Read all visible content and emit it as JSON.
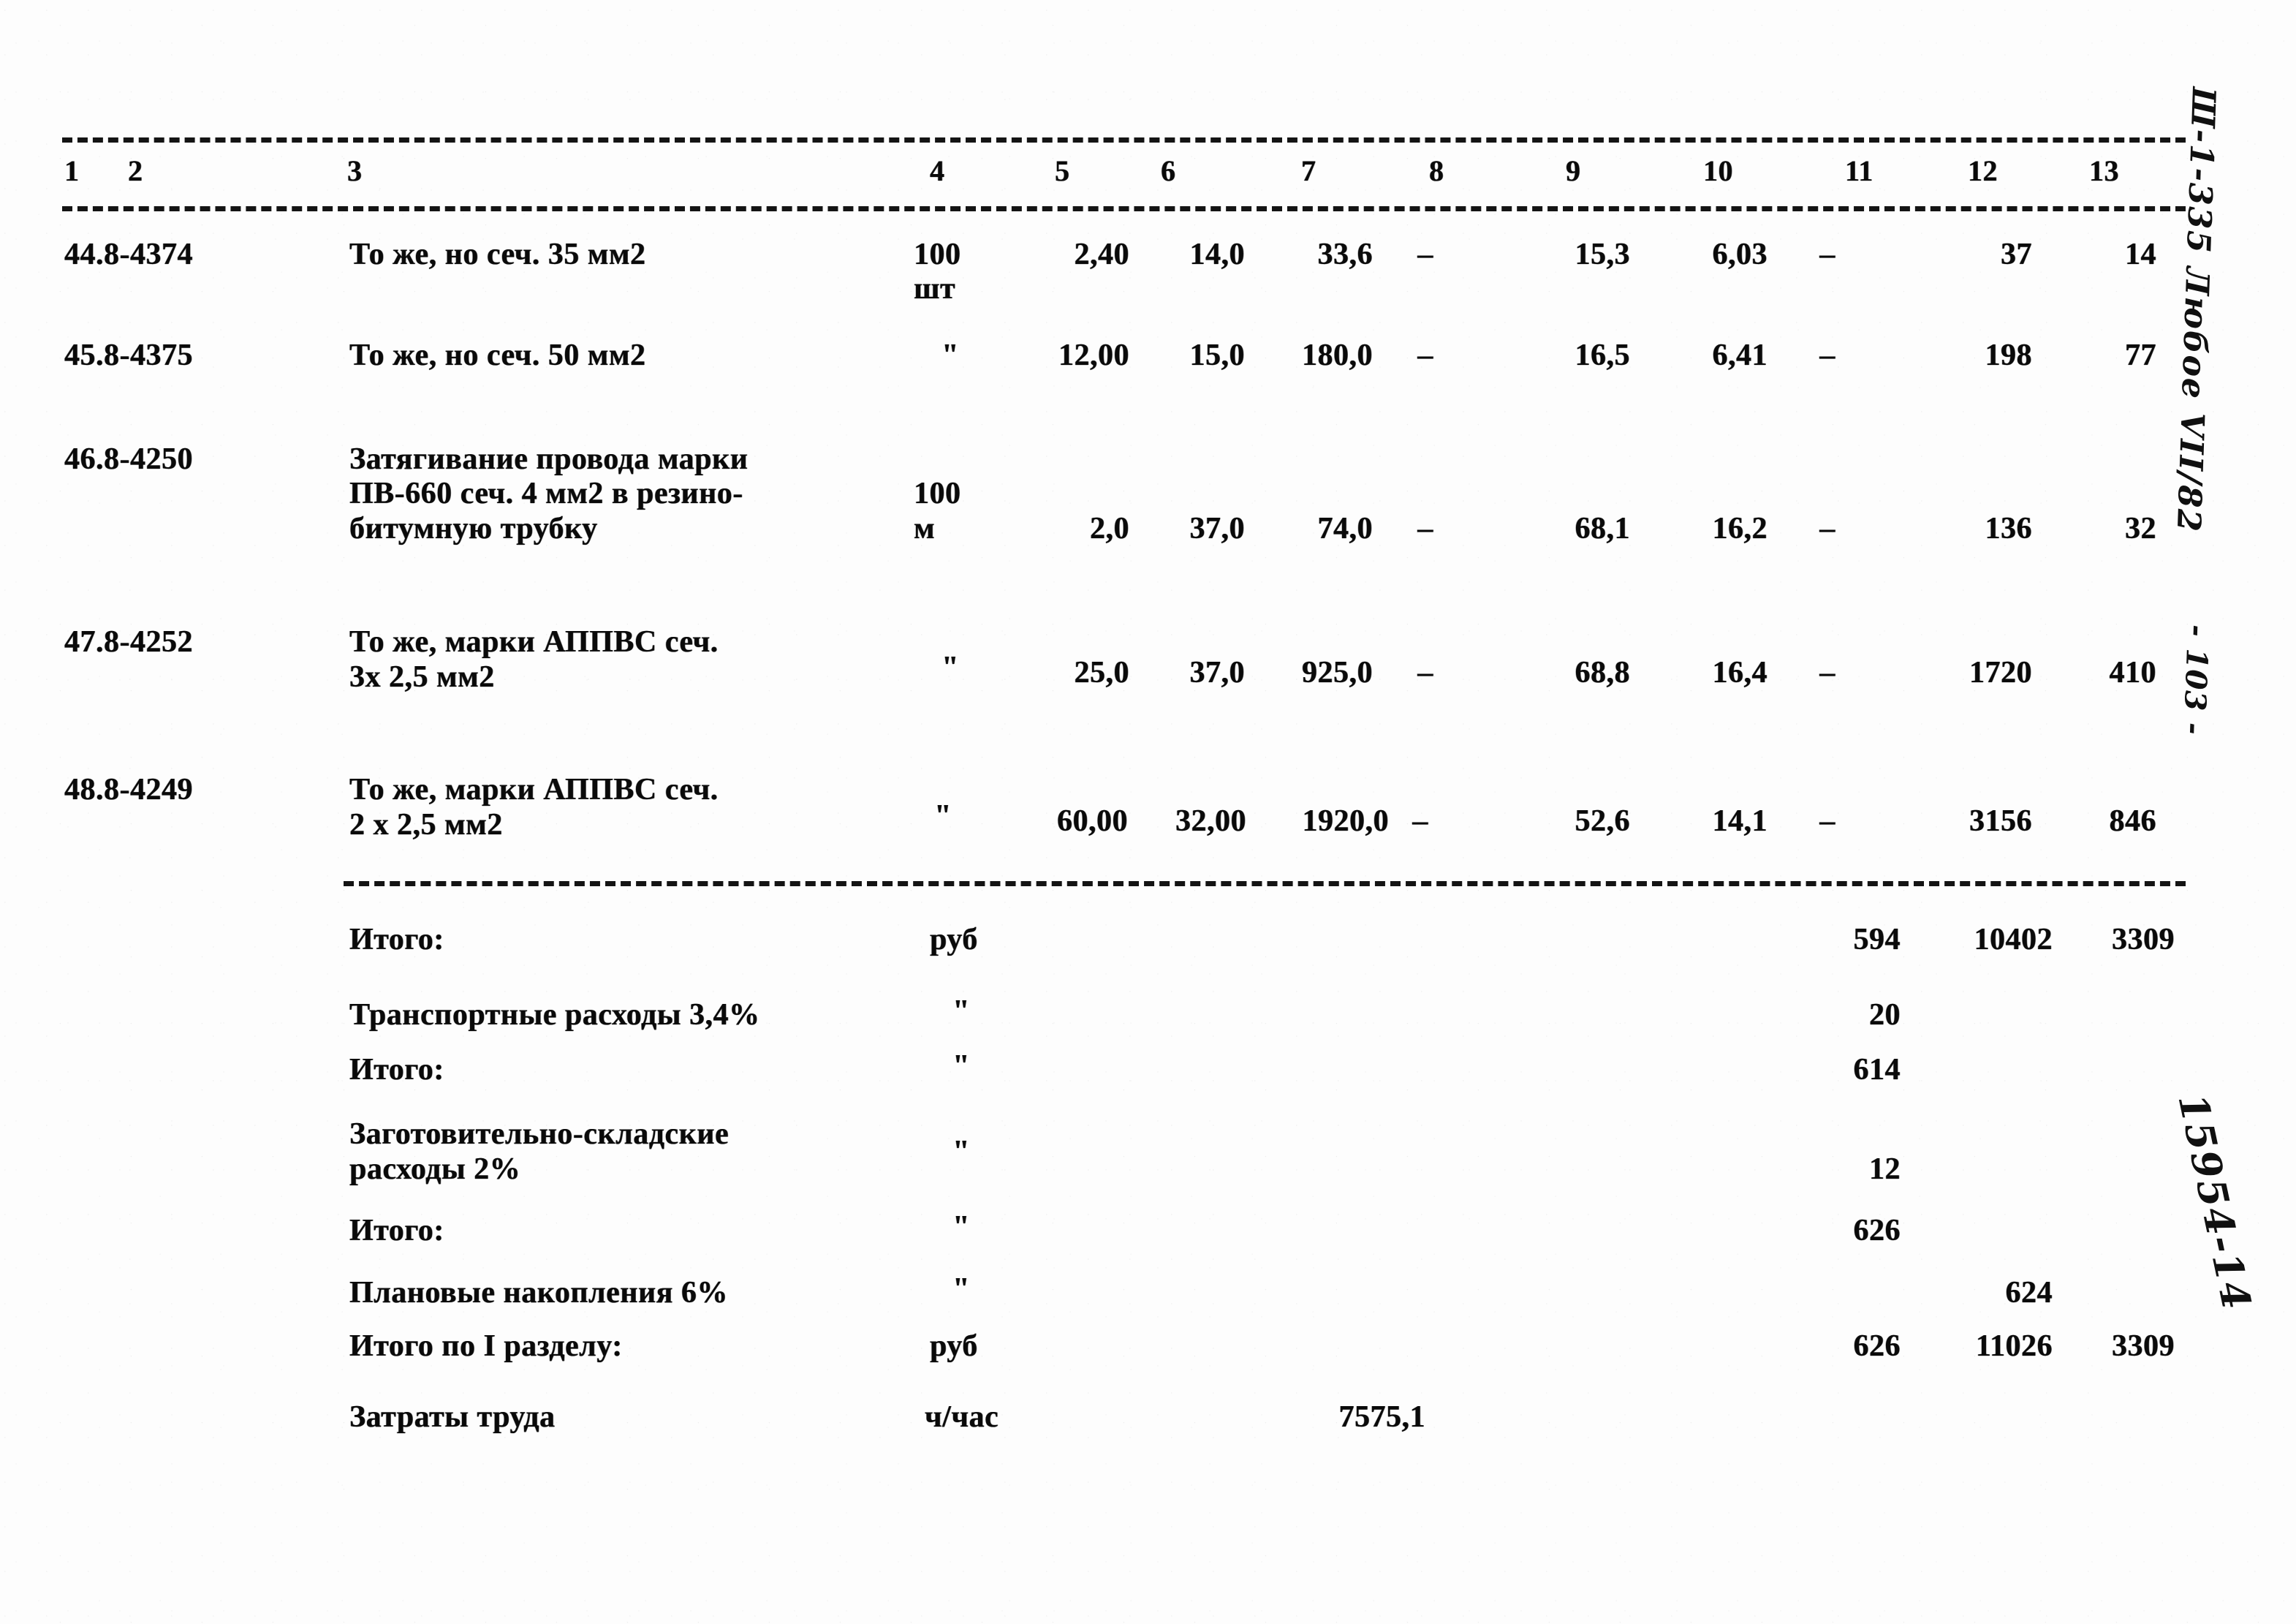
{
  "document": {
    "type": "estimate-table",
    "page_marker": "- 103 -",
    "margin_code": "Ш-1-335 Любое VII/82",
    "margin_stamp": "15954-14"
  },
  "table": {
    "column_headers": [
      "1",
      "2",
      "3",
      "4",
      "5",
      "6",
      "7",
      "8",
      "9",
      "10",
      "11",
      "12",
      "13"
    ],
    "rows": [
      {
        "num": "44.",
        "code": "8-4374",
        "num_code": "44.8-4374",
        "description": [
          "То же, но сеч. 35 мм2"
        ],
        "unit": [
          "100",
          "шт"
        ],
        "c5": "2,40",
        "c6": "14,0",
        "c7": "33,6",
        "c8": "–",
        "c9": "15,3",
        "c10": "6,03",
        "c11": "–",
        "c12": "37",
        "c13": "14"
      },
      {
        "num": "45.",
        "code": "8-4375",
        "num_code": "45.8-4375",
        "description": [
          "То же, но сеч. 50 мм2"
        ],
        "unit": [
          "\""
        ],
        "c5": "12,00",
        "c6": "15,0",
        "c7": "180,0",
        "c8": "–",
        "c9": "16,5",
        "c10": "6,41",
        "c11": "–",
        "c12": "198",
        "c13": "77"
      },
      {
        "num": "46.",
        "code": "8-4250",
        "num_code": "46.8-4250",
        "description": [
          "Затягивание провода марки",
          "ПВ-660 сеч. 4 мм2 в резино-",
          "битумную трубку"
        ],
        "unit": [
          "100",
          "м"
        ],
        "c5": "2,0",
        "c6": "37,0",
        "c7": "74,0",
        "c8": "–",
        "c9": "68,1",
        "c10": "16,2",
        "c11": "–",
        "c12": "136",
        "c13": "32"
      },
      {
        "num": "47.",
        "code": "8-4252",
        "num_code": "47.8-4252",
        "description": [
          "То же, марки АППВС сеч.",
          "3х 2,5 мм2"
        ],
        "unit": [
          "\""
        ],
        "c5": "25,0",
        "c6": "37,0",
        "c7": "925,0",
        "c8": "–",
        "c9": "68,8",
        "c10": "16,4",
        "c11": "–",
        "c12": "1720",
        "c13": "410"
      },
      {
        "num": "48.",
        "code": "8-4249",
        "num_code": "48.8-4249",
        "description": [
          "То же, марки АППВС сеч.",
          "2 х 2,5 мм2"
        ],
        "unit": [
          "\""
        ],
        "c5": "60,00",
        "c6": "32,00",
        "c7": "1920,0",
        "c8": "–",
        "c9": "52,6",
        "c10": "14,1",
        "c11": "–",
        "c12": "3156",
        "c13": "846"
      }
    ],
    "summary": [
      {
        "label": [
          "Итого:"
        ],
        "unit": "руб",
        "c7": "",
        "c11": "594",
        "c12": "10402",
        "c13": "3309"
      },
      {
        "label": [
          "Транспортные расходы 3,4%"
        ],
        "unit": "\"",
        "c7": "",
        "c11": "20",
        "c12": "",
        "c13": ""
      },
      {
        "label": [
          "Итого:"
        ],
        "unit": "\"",
        "c7": "",
        "c11": "614",
        "c12": "",
        "c13": ""
      },
      {
        "label": [
          "Заготовительно-складские",
          "расходы 2%"
        ],
        "unit": "\"",
        "c7": "",
        "c11": "12",
        "c12": "",
        "c13": ""
      },
      {
        "label": [
          "Итого:"
        ],
        "unit": "\"",
        "c7": "",
        "c11": "626",
        "c12": "",
        "c13": ""
      },
      {
        "label": [
          "Плановые накопления 6%"
        ],
        "unit": "\"",
        "c7": "",
        "c11": "",
        "c12": "624",
        "c13": ""
      },
      {
        "label": [
          "Итого по I разделу:"
        ],
        "unit": "руб",
        "c7": "",
        "c11": "626",
        "c12": "11026",
        "c13": "3309"
      },
      {
        "label": [
          "Затраты труда"
        ],
        "unit": "ч/час",
        "c7": "7575,1",
        "c11": "",
        "c12": "",
        "c13": ""
      }
    ]
  }
}
